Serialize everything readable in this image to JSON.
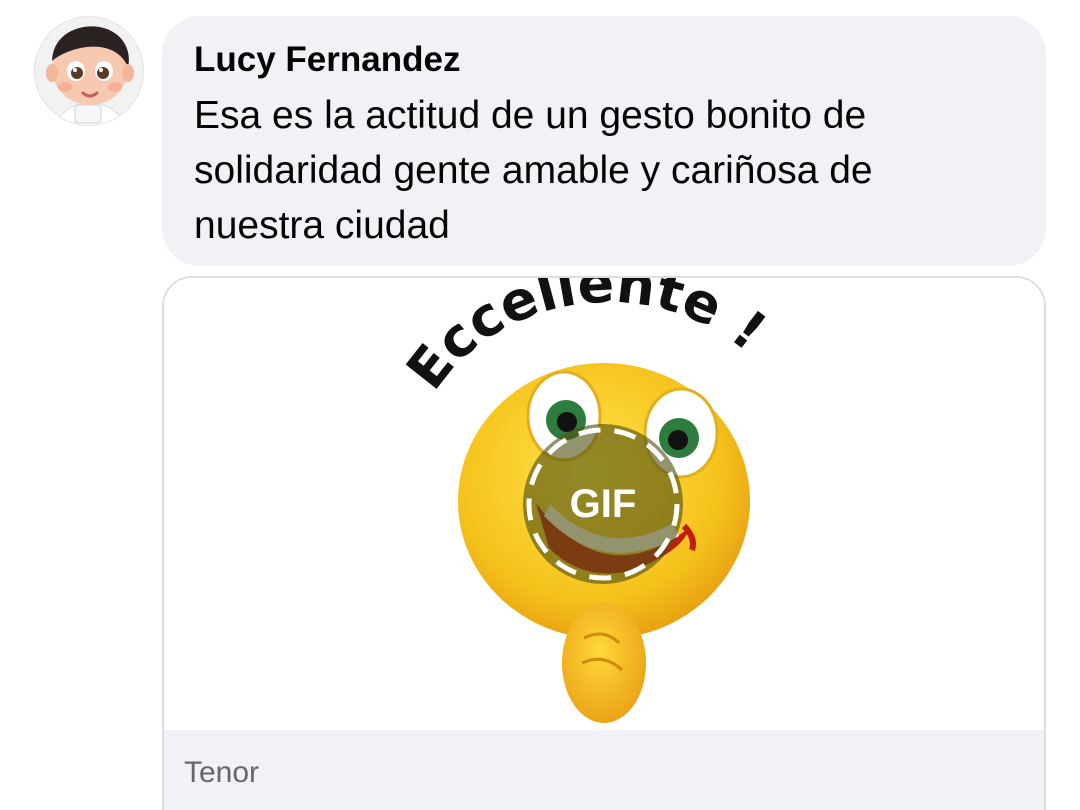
{
  "comment": {
    "author": "Lucy Fernandez",
    "text": "Esa es la actitud de un gesto bonito de solidaridad gente amable y cariñosa de nuestra ciudad",
    "avatar_icon": "baby-avatar"
  },
  "gif": {
    "sticker_text": "Eccellente !",
    "play_label": "GIF",
    "source": "Tenor",
    "sticker_icon": "laughing-thumbs-up-emoji"
  },
  "colors": {
    "bubble_bg": "#f0f2f5",
    "text": "#050505",
    "secondary_text": "#65676b",
    "emoji_yellow": "#f5c21b"
  }
}
